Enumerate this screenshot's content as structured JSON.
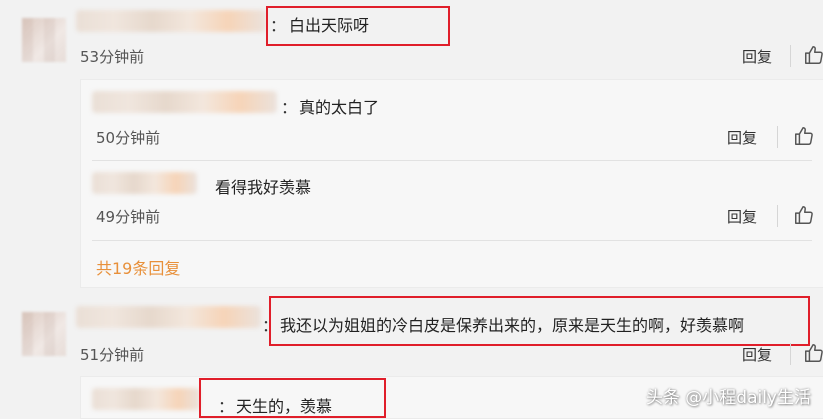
{
  "comments": [
    {
      "text": "白出天际呀",
      "time": "53分钟前",
      "reply": "回复"
    },
    {
      "text": "我还以为姐姐的冷白皮是保养出来的，原来是天生的啊，好羡慕啊",
      "time": "51分钟前",
      "reply": "回复"
    }
  ],
  "replies": [
    {
      "text": "真的太白了",
      "time": "50分钟前",
      "reply": "回复"
    },
    {
      "text": "看得我好羡慕",
      "time": "49分钟前",
      "reply": "回复"
    }
  ],
  "nested_reply": {
    "text": "天生的，羡慕"
  },
  "more_replies": "共19条回复",
  "colon": "：",
  "watermark": "头条 @小程daily生活",
  "colors": {
    "highlight_box": "#e01e2a",
    "more_link": "#e8903a"
  },
  "icons": [
    "thumbs-up-icon"
  ]
}
